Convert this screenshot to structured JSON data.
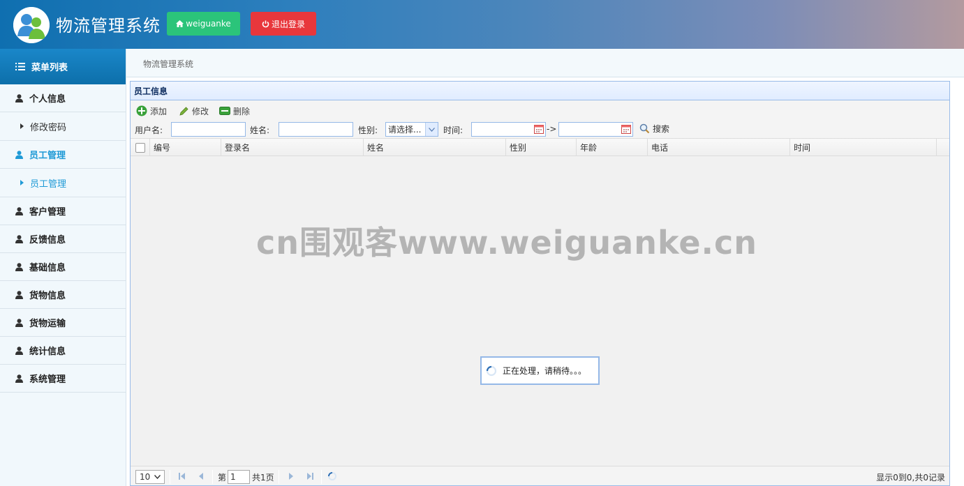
{
  "header": {
    "title": "物流管理系统",
    "user_button": "weiguanke",
    "logout_button": "退出登录"
  },
  "sidebar": {
    "menu_title": "菜单列表",
    "items": [
      {
        "label": "个人信息",
        "type": "group"
      },
      {
        "label": "修改密码",
        "type": "sub"
      },
      {
        "label": "员工管理",
        "type": "group",
        "active": true
      },
      {
        "label": "员工管理",
        "type": "sub",
        "active": true
      },
      {
        "label": "客户管理",
        "type": "group"
      },
      {
        "label": "反馈信息",
        "type": "group"
      },
      {
        "label": "基础信息",
        "type": "group"
      },
      {
        "label": "货物信息",
        "type": "group"
      },
      {
        "label": "货物运输",
        "type": "group"
      },
      {
        "label": "统计信息",
        "type": "group"
      },
      {
        "label": "系统管理",
        "type": "group"
      }
    ]
  },
  "breadcrumb": "物流管理系统",
  "panel": {
    "title": "员工信息",
    "toolbar": {
      "add": "添加",
      "edit": "修改",
      "delete": "删除"
    },
    "search": {
      "username_label": "用户名:",
      "name_label": "姓名:",
      "gender_label": "性别:",
      "gender_value": "请选择...",
      "time_label": "时间:",
      "range_sep": "->",
      "search_button": "搜索"
    },
    "columns": [
      "编号",
      "登录名",
      "姓名",
      "性别",
      "年龄",
      "电话",
      "时间"
    ],
    "watermark": "cn围观客www.weiguanke.cn",
    "loading_text": "正在处理，请稍待。。。",
    "pager": {
      "page_size": "10",
      "page_prefix": "第",
      "page_value": "1",
      "page_total": "共1页",
      "info": "显示0到0,共0记录"
    }
  },
  "colors": {
    "accent": "#1f9ad6",
    "green": "#2bc47a",
    "red": "#e8373c"
  }
}
